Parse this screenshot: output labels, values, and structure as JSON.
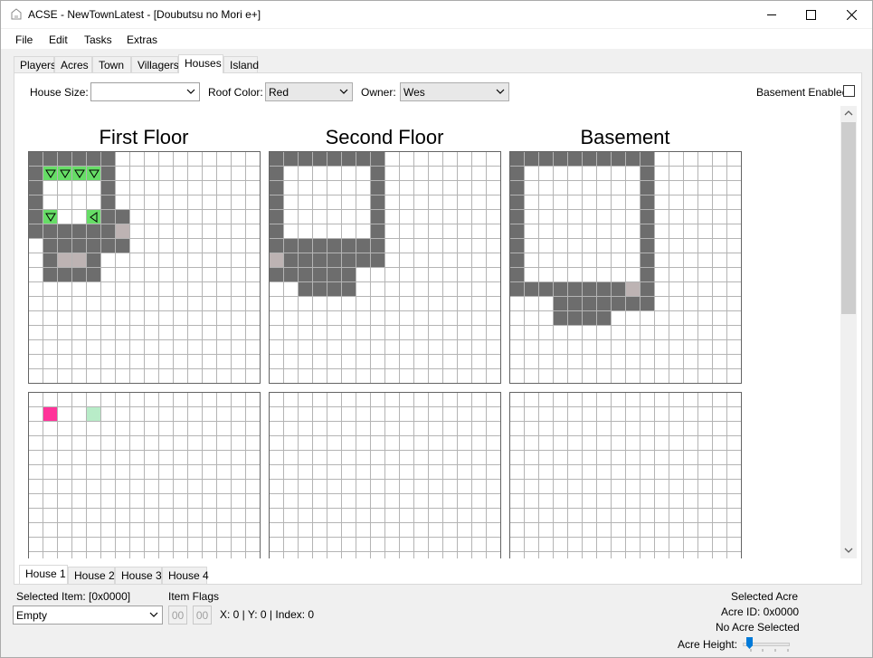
{
  "window": {
    "title": "ACSE - NewTownLatest - [Doubutsu no Mori e+]",
    "controls": {
      "minimize": "minimize-icon",
      "maximize": "maximize-icon",
      "close": "close-icon"
    }
  },
  "menu": [
    "File",
    "Edit",
    "Tasks",
    "Extras"
  ],
  "tabs": [
    {
      "label": "Players"
    },
    {
      "label": "Acres"
    },
    {
      "label": "Town"
    },
    {
      "label": "Villagers"
    },
    {
      "label": "Houses",
      "active": true
    },
    {
      "label": "Island"
    }
  ],
  "houses_panel": {
    "house_size_label": "House Size:",
    "house_size_value": "",
    "roof_color_label": "Roof Color:",
    "roof_color_value": "Red",
    "owner_label": "Owner:",
    "owner_value": "Wes",
    "basement_label": "Basement Enabled",
    "basement_checked": false,
    "floors": [
      {
        "title": "First Floor"
      },
      {
        "title": "Second Floor"
      },
      {
        "title": "Basement"
      }
    ]
  },
  "house_tabs": [
    {
      "label": "House 1",
      "active": true
    },
    {
      "label": "House 2"
    },
    {
      "label": "House 3"
    },
    {
      "label": "House 4"
    }
  ],
  "status": {
    "selected_item_label": "Selected Item: [0x0000]",
    "selected_item_value": "Empty",
    "item_flags_label": "Item Flags",
    "flag1": "00",
    "flag2": "00",
    "position_text": "X: 0 | Y: 0 | Index: 0",
    "selected_acre_label": "Selected Acre",
    "acre_id_text": "Acre ID: 0x0000",
    "no_acre_text": "No Acre Selected",
    "acre_height_label": "Acre Height:"
  },
  "colors": {
    "wall": "#6d6d6d",
    "item_green": "#66dd66",
    "door": "#bdb3b3",
    "grid_line": "#b4b4b4",
    "pink_item": "#ff3399",
    "light_green_item": "#b8ecc8"
  }
}
